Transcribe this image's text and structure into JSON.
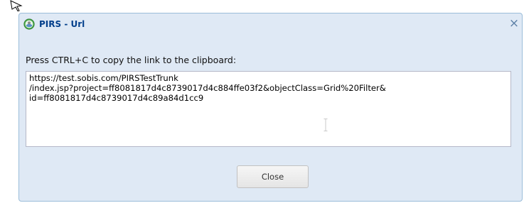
{
  "dialog": {
    "title": "PIRS - Url",
    "close_glyph": "×",
    "prompt": "Press CTRL+C to copy the link to the clipboard:",
    "url_text": "https://test.sobis.com/PIRSTestTrunk\n/index.jsp?project=ff8081817d4c8739017d4c884ffe03f2&objectClass=Grid%20Filter&\nid=ff8081817d4c8739017d4c89a84d1cc9",
    "close_button_label": "Close"
  },
  "icons": {
    "app": "pirs-globe-icon",
    "close": "close-icon",
    "cursor": "mouse-pointer-icon",
    "text_cursor": "text-cursor-icon"
  },
  "colors": {
    "dialog_background": "#dfe9f5",
    "dialog_border": "#9bbdd9",
    "title_text": "#04408c",
    "close_icon": "#5b7fa6"
  }
}
